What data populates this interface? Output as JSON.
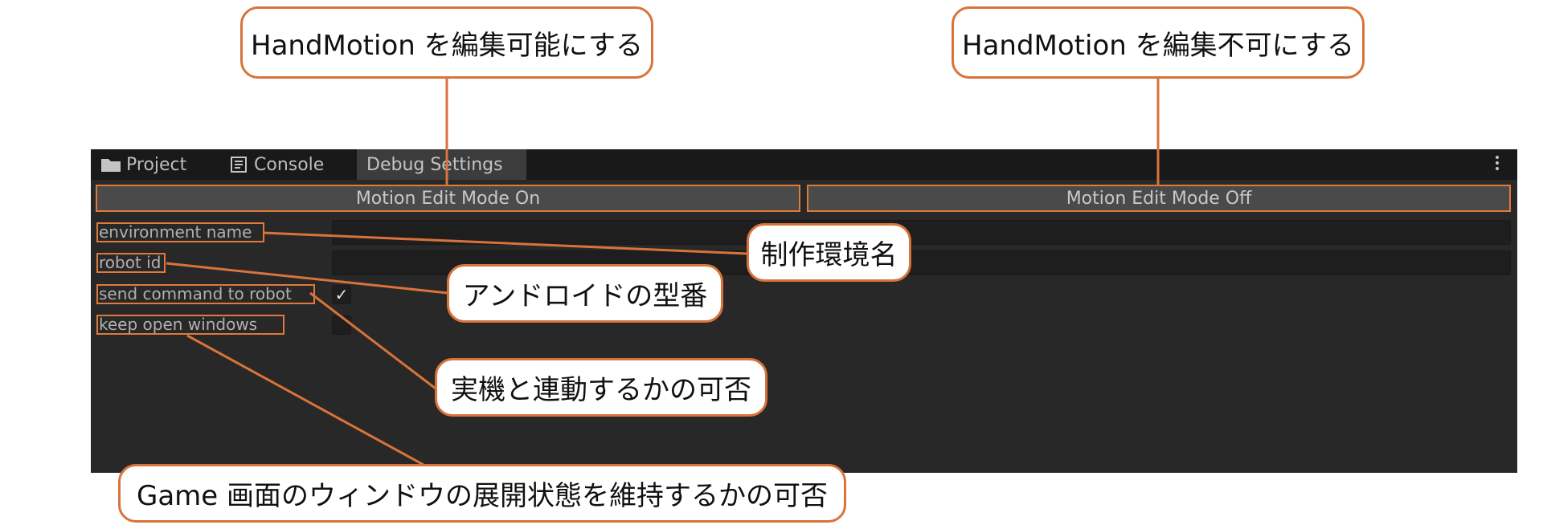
{
  "tabs": [
    {
      "label": "Project",
      "icon": "folder-icon"
    },
    {
      "label": "Console",
      "icon": "console-icon"
    },
    {
      "label": "Debug Settings"
    }
  ],
  "buttons": {
    "motion_on": "Motion Edit Mode On",
    "motion_off": "Motion Edit Mode Off"
  },
  "fields": {
    "environment_name": {
      "label": "environment name",
      "value": ""
    },
    "robot_id": {
      "label": "robot id",
      "value": ""
    },
    "send_command": {
      "label": "send command to robot",
      "checked": true,
      "mark": "✓"
    },
    "keep_open": {
      "label": "keep open windows",
      "checked": false
    }
  },
  "annotations": {
    "motion_on": "HandMotion を編集可能にする",
    "motion_off": "HandMotion を編集不可にする",
    "environment_name": "制作環境名",
    "robot_id": "アンドロイドの型番",
    "send_command": "実機と連動するかの可否",
    "keep_open": "Game 画面のウィンドウの展開状態を維持するかの可否"
  },
  "colors": {
    "accent": "#e07a3a",
    "panel_bg": "#282828",
    "tabbar_bg": "#191919",
    "active_tab_bg": "#3c3c3c",
    "button_bg": "#4a4a4a"
  }
}
